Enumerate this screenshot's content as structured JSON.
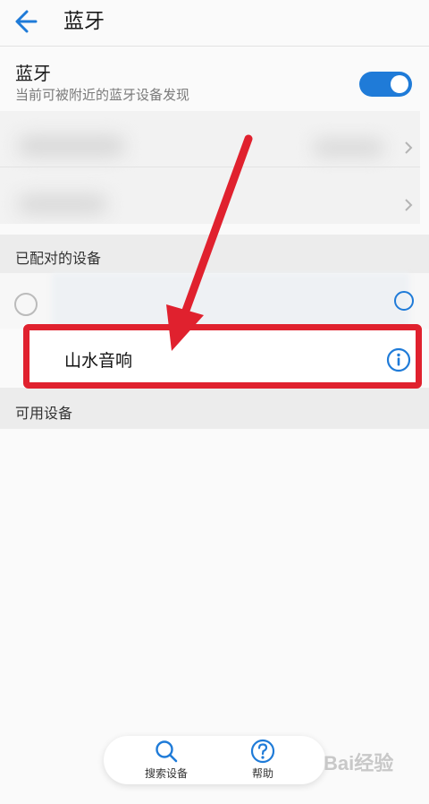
{
  "header": {
    "title": "蓝牙",
    "back_icon": "arrow-left-icon"
  },
  "bluetooth": {
    "title": "蓝牙",
    "subtitle": "当前可被附近的蓝牙设备发现",
    "enabled": true,
    "accent_color": "#1f7bd8"
  },
  "sections": {
    "paired_label": "已配对的设备",
    "available_label": "可用设备"
  },
  "paired_devices": [
    {
      "name": "山水音响",
      "icon": "info-icon"
    }
  ],
  "bottom_bar": {
    "items": [
      {
        "label": "搜索设备",
        "icon": "search-icon"
      },
      {
        "label": "帮助",
        "icon": "help-icon"
      }
    ]
  },
  "annotation_color": "#e0212e"
}
